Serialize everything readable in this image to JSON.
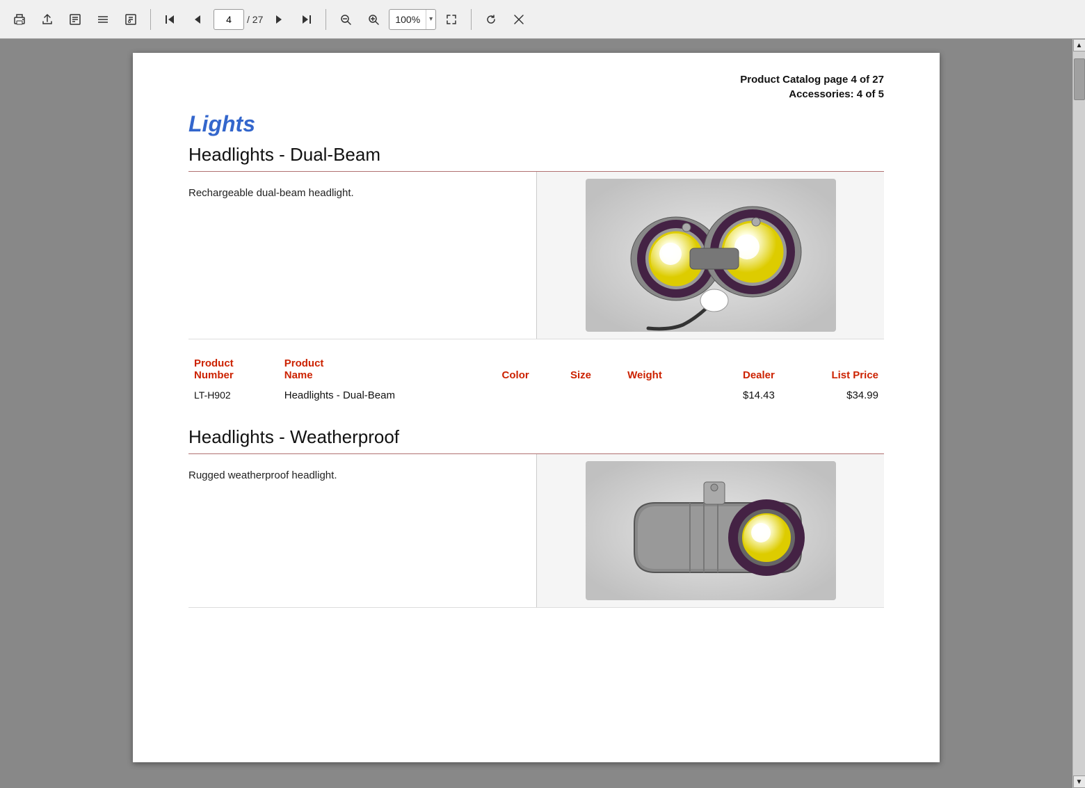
{
  "toolbar": {
    "print_label": "🖨",
    "share_label": "📤",
    "annotate_label": "📝",
    "menu_label": "☰",
    "props_label": "⚙",
    "first_label": "⏮",
    "prev_label": "◀",
    "next_label": "▶",
    "last_label": "⏭",
    "zoom_out_label": "−",
    "zoom_in_label": "+",
    "fullscreen_label": "⛶",
    "refresh_label": "↻",
    "close_label": "✕",
    "current_page": "4",
    "total_pages": "/ 27",
    "zoom_value": "100%"
  },
  "page": {
    "header": {
      "title": "Product Catalog page 4 of 27",
      "subtitle": "Accessories: 4 of 5"
    },
    "section_title": "Lights",
    "products": [
      {
        "id": "product-dual-beam",
        "title": "Headlights - Dual-Beam",
        "description": "Rechargeable dual-beam headlight.",
        "table": {
          "headers": [
            "Product Number",
            "Product Name",
            "Color",
            "Size",
            "Weight",
            "Dealer",
            "List Price"
          ],
          "rows": [
            {
              "number": "LT-H902",
              "name": "Headlights - Dual-Beam",
              "color": "",
              "size": "",
              "weight": "",
              "dealer": "$14.43",
              "list_price": "$34.99"
            }
          ]
        }
      },
      {
        "id": "product-weatherproof",
        "title": "Headlights - Weatherproof",
        "description": "Rugged weatherproof headlight."
      }
    ]
  }
}
